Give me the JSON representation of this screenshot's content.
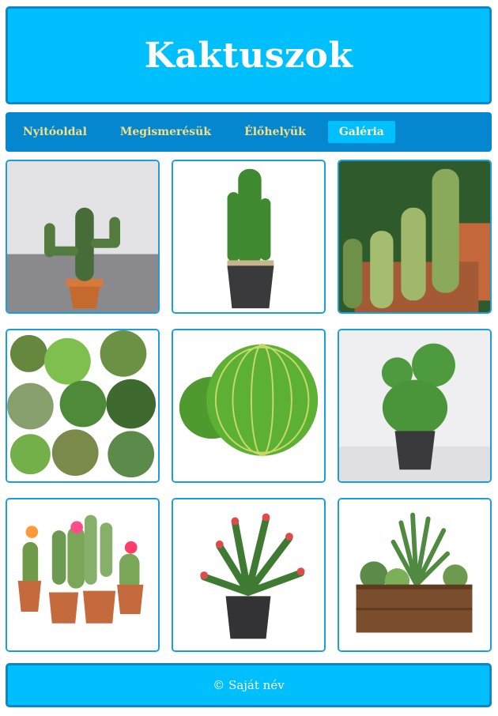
{
  "header": {
    "title": "Kaktuszok"
  },
  "nav": {
    "items": [
      {
        "label": "Nyitóoldal",
        "active": false
      },
      {
        "label": "Megismerésük",
        "active": false
      },
      {
        "label": "Élőhelyük",
        "active": false
      },
      {
        "label": "Galéria",
        "active": true
      }
    ]
  },
  "gallery": {
    "images": [
      {
        "icon": "cactus-pot-gray-fur-photo"
      },
      {
        "icon": "columnar-cactus-black-pot-photo"
      },
      {
        "icon": "cactus-group-greenhouse-photo"
      },
      {
        "icon": "succulents-top-view-photo"
      },
      {
        "icon": "barrel-cactus-cushion-photo"
      },
      {
        "icon": "round-cactus-black-pot-photo"
      },
      {
        "icon": "flowering-cacti-pots-photo"
      },
      {
        "icon": "christmas-cactus-photo"
      },
      {
        "icon": "succulents-wooden-box-photo"
      }
    ]
  },
  "footer": {
    "text": "© Saját név"
  },
  "colors": {
    "header_bg": "#00bfff",
    "border": "#0a86c9",
    "nav_bg": "#0587cf",
    "nav_text": "#f2e086",
    "tile_border": "#1a9ee0"
  }
}
